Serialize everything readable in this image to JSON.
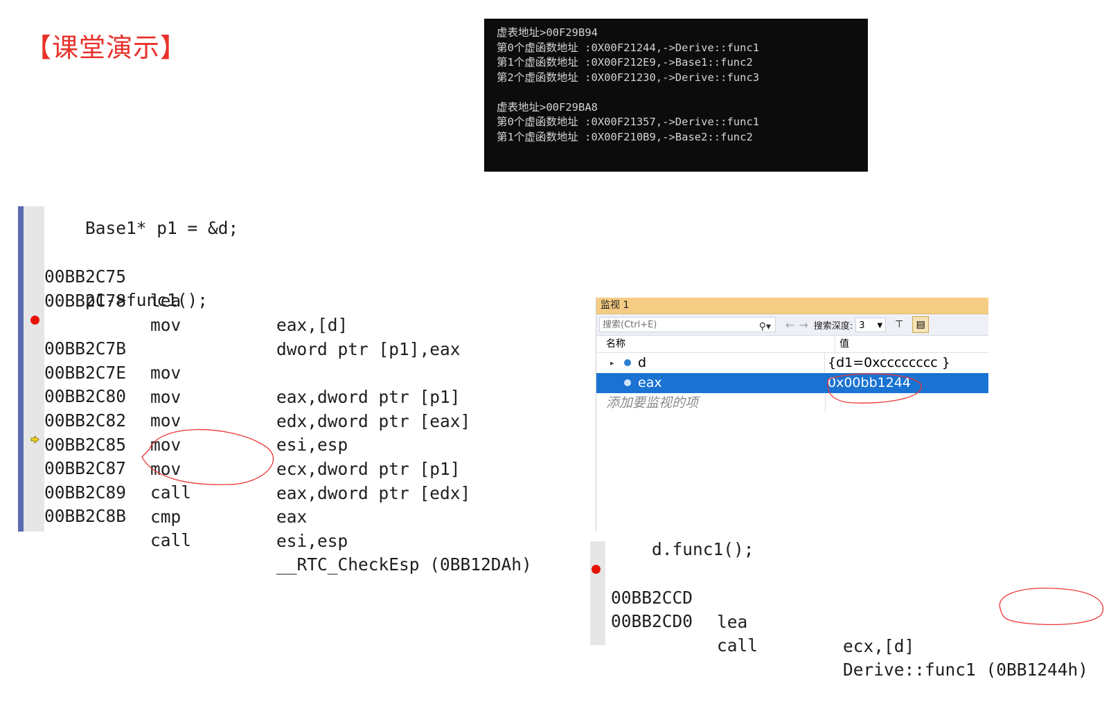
{
  "slide": {
    "title": "【课堂演示】",
    "accent_color": "#e8322b"
  },
  "console": {
    "lines": [
      "虚表地址>00F29B94",
      "第0个虚函数地址 :0X00F21244,->Derive::func1",
      "第1个虚函数地址 :0X00F212E9,->Base1::func2",
      "第2个虚函数地址 :0X00F21230,->Derive::func3",
      "",
      "虚表地址>00F29BA8",
      "第0个虚函数地址 :0X00F21357,->Derive::func1",
      "第1个虚函数地址 :0X00F210B9,->Base2::func2"
    ]
  },
  "disasm1": {
    "source_line_1": "    Base1* p1 = &d;",
    "rows": [
      {
        "addr": "00BB2C75",
        "op": "lea",
        "arg": "eax,[d]"
      },
      {
        "addr": "00BB2C78",
        "op": "mov",
        "arg": "dword ptr [p1],eax"
      }
    ],
    "source_line_2": "    p1->func1();",
    "rows2": [
      {
        "addr": "00BB2C7B",
        "op": "mov",
        "arg": "eax,dword ptr [p1]"
      },
      {
        "addr": "00BB2C7E",
        "op": "mov",
        "arg": "edx,dword ptr [eax]"
      },
      {
        "addr": "00BB2C80",
        "op": "mov",
        "arg": "esi,esp"
      },
      {
        "addr": "00BB2C82",
        "op": "mov",
        "arg": "ecx,dword ptr [p1]"
      },
      {
        "addr": "00BB2C85",
        "op": "mov",
        "arg": "eax,dword ptr [edx]"
      },
      {
        "addr": "00BB2C87",
        "op": "call",
        "arg": "eax"
      },
      {
        "addr": "00BB2C89",
        "op": "cmp",
        "arg": "esi,esp"
      },
      {
        "addr": "00BB2C8B",
        "op": "call",
        "arg": "__RTC_CheckEsp (0BB12DAh)"
      }
    ]
  },
  "watch": {
    "title": "监视 1",
    "search_placeholder": "搜索(Ctrl+E)",
    "search_icon": "search-icon",
    "nav_back": "←",
    "nav_forward": "→",
    "depth_label": "搜索深度:",
    "depth_value": "3",
    "col_name": "名称",
    "col_value": "值",
    "rows": [
      {
        "name": "d",
        "value": "{d1=0xcccccccc }"
      },
      {
        "name": "eax",
        "value": "0x00bb1244"
      }
    ],
    "add_item": "添加要监视的项",
    "selected_color": "#1a73d2"
  },
  "disasm2": {
    "source_line": "    d.func1();",
    "rows": [
      {
        "addr": "00BB2CCD",
        "op": "lea",
        "arg": "ecx,[d]"
      },
      {
        "addr": "00BB2CD0",
        "op": "call",
        "arg": "Derive::func1 (0BB1244h)"
      }
    ]
  }
}
